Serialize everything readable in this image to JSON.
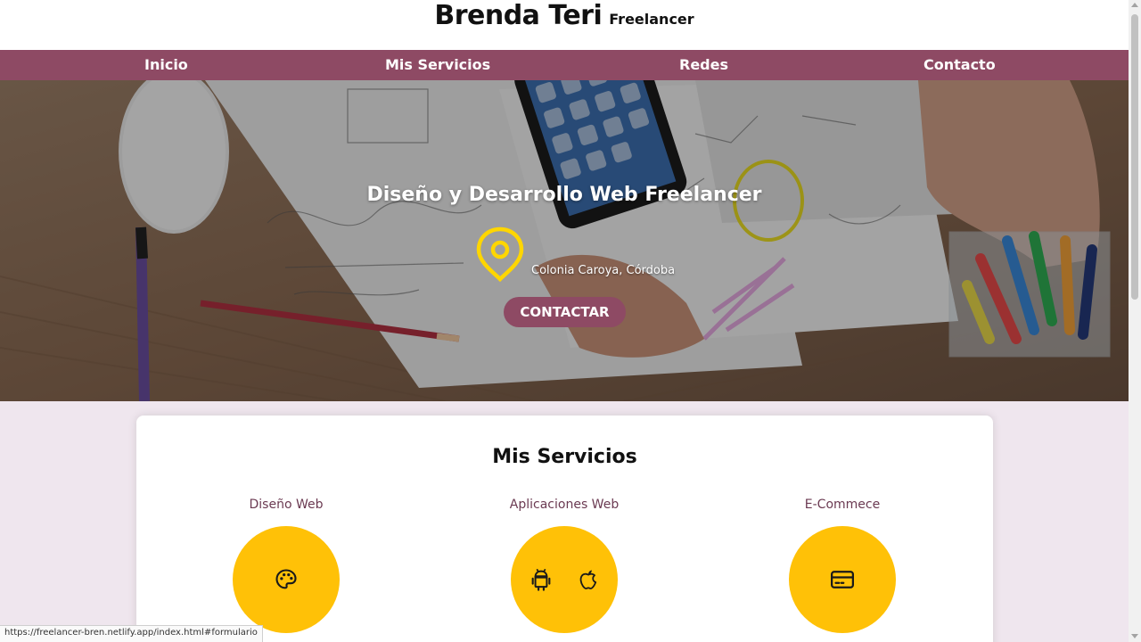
{
  "header": {
    "brand_name": "Brenda Teri",
    "brand_subtitle": "Freelancer"
  },
  "nav": {
    "items": [
      {
        "label": "Inicio"
      },
      {
        "label": "Mis Servicios"
      },
      {
        "label": "Redes"
      },
      {
        "label": "Contacto"
      }
    ]
  },
  "hero": {
    "title": "Diseño y Desarrollo Web Freelancer",
    "location": "Colonia Caroya, Córdoba",
    "location_icon": "map-pin-icon",
    "cta_label": "CONTACTAR"
  },
  "services": {
    "title": "Mis Servicios",
    "items": [
      {
        "label": "Diseño Web",
        "icons": [
          "palette-icon"
        ]
      },
      {
        "label": "Aplicaciones Web",
        "icons": [
          "android-icon",
          "apple-icon"
        ]
      },
      {
        "label": "E-Commece",
        "icons": [
          "credit-card-icon"
        ]
      }
    ]
  },
  "status_bar": {
    "url": "https://freelancer-bren.netlify.app/index.html#formulario"
  },
  "colors": {
    "brand": "#8e4a64",
    "accent": "#ffc107",
    "pin": "#ffd600",
    "background": "#efe6ee"
  }
}
